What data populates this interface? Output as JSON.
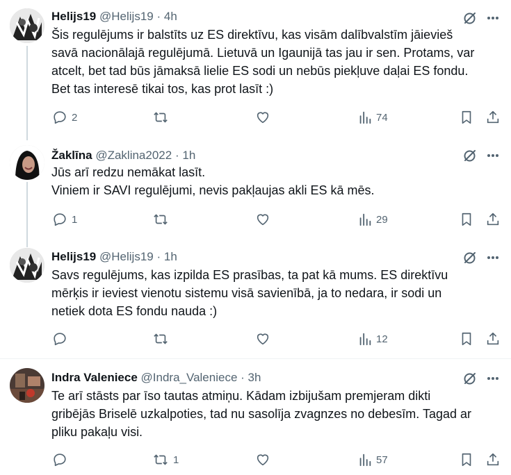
{
  "colors": {
    "text": "#0f1419",
    "muted": "#536471",
    "thread_line": "#cfd9de",
    "divider": "#eff3f4"
  },
  "tweets": [
    {
      "name": "Helijs19",
      "handle": "@Helijs19",
      "sep": "·",
      "time": "4h",
      "lines": [
        "Šis regulējums ir balstīts uz ES direktīvu, kas visām dalībvalstīm jāievieš",
        "savā nacionālajā regulējumā. Lietuvā un Igaunijā tas jau ir sen. Protams, var",
        "atcelt, bet tad būs jāmaksā lielie ES sodi un nebūs piekļuve daļai ES fondu.",
        "Bet tas interesē tikai tos, kas prot lasīt :)"
      ],
      "replies": "2",
      "reposts": "",
      "likes": "",
      "views": "74"
    },
    {
      "name": "Žaklīna",
      "handle": "@Zaklina2022",
      "sep": "·",
      "time": "1h",
      "lines": [
        "Jūs arī redzu nemākat lasīt.",
        "Viniem ir SAVI regulējumi, nevis pakļaujas akli ES kā mēs."
      ],
      "replies": "1",
      "reposts": "",
      "likes": "",
      "views": "29"
    },
    {
      "name": "Helijs19",
      "handle": "@Helijs19",
      "sep": "·",
      "time": "1h",
      "lines": [
        "Savs regulējums, kas izpilda ES prasības, ta pat kā mums. ES direktīvu",
        "mērķis ir ieviest vienotu sistemu visā savienībā, ja to nedara, ir sodi un",
        "netiek dota ES fondu nauda :)"
      ],
      "replies": "",
      "reposts": "",
      "likes": "",
      "views": "12"
    },
    {
      "name": "Indra Valeniece",
      "handle": "@Indra_Valeniece",
      "sep": "·",
      "time": "3h",
      "lines": [
        "Te arī stāsts par īso tautas atmiņu. Kādam izbijušam premjeram dikti",
        "gribējās Briselē uzkalpoties, tad nu sasolīja zvagnzes no debesīm. Tagad ar",
        "pliku pakaļu visi."
      ],
      "replies": "",
      "reposts": "1",
      "likes": "",
      "views": "57"
    }
  ]
}
